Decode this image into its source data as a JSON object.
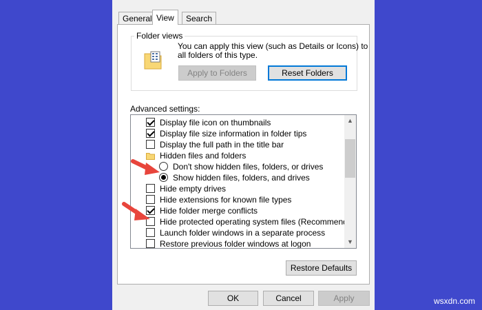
{
  "tabs": [
    {
      "label": "General"
    },
    {
      "label": "View"
    },
    {
      "label": "Search"
    }
  ],
  "folder_views": {
    "title": "Folder views",
    "description_line1": "You can apply this view (such as Details or Icons) to",
    "description_line2": "all folders of this type.",
    "apply_button": "Apply to Folders",
    "reset_button": "Reset Folders"
  },
  "advanced": {
    "title": "Advanced settings:",
    "items": [
      {
        "label": "Display file icon on thumbnails",
        "type": "checkbox",
        "checked": true
      },
      {
        "label": "Display file size information in folder tips",
        "type": "checkbox",
        "checked": true
      },
      {
        "label": "Display the full path in the title bar",
        "type": "checkbox",
        "checked": false
      },
      {
        "label": "Hidden files and folders",
        "type": "folder"
      },
      {
        "label": "Don't show hidden files, folders, or drives",
        "type": "radio",
        "checked": false
      },
      {
        "label": "Show hidden files, folders, and drives",
        "type": "radio",
        "checked": true
      },
      {
        "label": "Hide empty drives",
        "type": "checkbox",
        "checked": false
      },
      {
        "label": "Hide extensions for known file types",
        "type": "checkbox",
        "checked": false
      },
      {
        "label": "Hide folder merge conflicts",
        "type": "checkbox",
        "checked": true
      },
      {
        "label": "Hide protected operating system files (Recommended)",
        "type": "checkbox",
        "checked": false
      },
      {
        "label": "Launch folder windows in a separate process",
        "type": "checkbox",
        "checked": false
      },
      {
        "label": "Restore previous folder windows at logon",
        "type": "checkbox",
        "checked": false
      }
    ],
    "restore_button": "Restore Defaults"
  },
  "footer": {
    "ok": "OK",
    "cancel": "Cancel",
    "apply": "Apply"
  },
  "colors": {
    "background": "#3f48cc",
    "annotation_arrow": "#e8453c",
    "focus_border": "#0078d7"
  },
  "watermark": "wsxdn.com"
}
